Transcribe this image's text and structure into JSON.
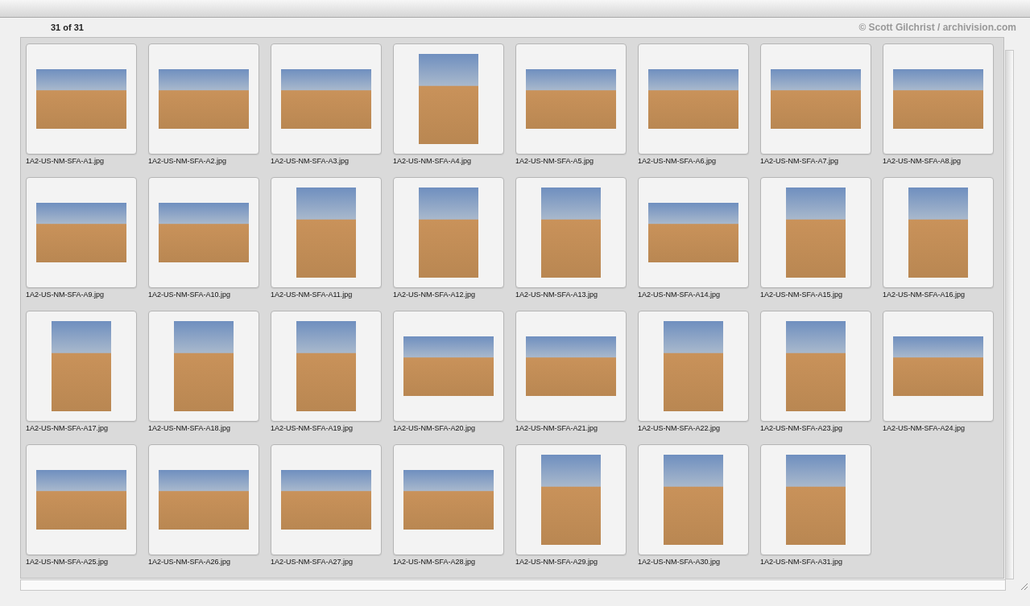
{
  "counter": "31 of 31",
  "credit": "© Scott Gilchrist / archivision.com",
  "thumbnails": [
    {
      "filename": "1A2-US-NM-SFA-A1.jpg",
      "kind": "landscape"
    },
    {
      "filename": "1A2-US-NM-SFA-A2.jpg",
      "kind": "landscape"
    },
    {
      "filename": "1A2-US-NM-SFA-A3.jpg",
      "kind": "landscape"
    },
    {
      "filename": "1A2-US-NM-SFA-A4.jpg",
      "kind": "portrait"
    },
    {
      "filename": "1A2-US-NM-SFA-A5.jpg",
      "kind": "landscape"
    },
    {
      "filename": "1A2-US-NM-SFA-A6.jpg",
      "kind": "landscape"
    },
    {
      "filename": "1A2-US-NM-SFA-A7.jpg",
      "kind": "landscape"
    },
    {
      "filename": "1A2-US-NM-SFA-A8.jpg",
      "kind": "landscape"
    },
    {
      "filename": "1A2-US-NM-SFA-A9.jpg",
      "kind": "landscape"
    },
    {
      "filename": "1A2-US-NM-SFA-A10.jpg",
      "kind": "landscape"
    },
    {
      "filename": "1A2-US-NM-SFA-A11.jpg",
      "kind": "portrait"
    },
    {
      "filename": "1A2-US-NM-SFA-A12.jpg",
      "kind": "portrait"
    },
    {
      "filename": "1A2-US-NM-SFA-A13.jpg",
      "kind": "portrait"
    },
    {
      "filename": "1A2-US-NM-SFA-A14.jpg",
      "kind": "landscape"
    },
    {
      "filename": "1A2-US-NM-SFA-A15.jpg",
      "kind": "portrait"
    },
    {
      "filename": "1A2-US-NM-SFA-A16.jpg",
      "kind": "portrait"
    },
    {
      "filename": "1A2-US-NM-SFA-A17.jpg",
      "kind": "portrait"
    },
    {
      "filename": "1A2-US-NM-SFA-A18.jpg",
      "kind": "portrait"
    },
    {
      "filename": "1A2-US-NM-SFA-A19.jpg",
      "kind": "portrait"
    },
    {
      "filename": "1A2-US-NM-SFA-A20.jpg",
      "kind": "landscape"
    },
    {
      "filename": "1A2-US-NM-SFA-A21.jpg",
      "kind": "landscape"
    },
    {
      "filename": "1A2-US-NM-SFA-A22.jpg",
      "kind": "portrait"
    },
    {
      "filename": "1A2-US-NM-SFA-A23.jpg",
      "kind": "portrait"
    },
    {
      "filename": "1A2-US-NM-SFA-A24.jpg",
      "kind": "landscape"
    },
    {
      "filename": "1A2-US-NM-SFA-A25.jpg",
      "kind": "landscape"
    },
    {
      "filename": "1A2-US-NM-SFA-A26.jpg",
      "kind": "landscape"
    },
    {
      "filename": "1A2-US-NM-SFA-A27.jpg",
      "kind": "landscape"
    },
    {
      "filename": "1A2-US-NM-SFA-A28.jpg",
      "kind": "landscape"
    },
    {
      "filename": "1A2-US-NM-SFA-A29.jpg",
      "kind": "portrait"
    },
    {
      "filename": "1A2-US-NM-SFA-A30.jpg",
      "kind": "portrait"
    },
    {
      "filename": "1A2-US-NM-SFA-A31.jpg",
      "kind": "portrait"
    }
  ]
}
